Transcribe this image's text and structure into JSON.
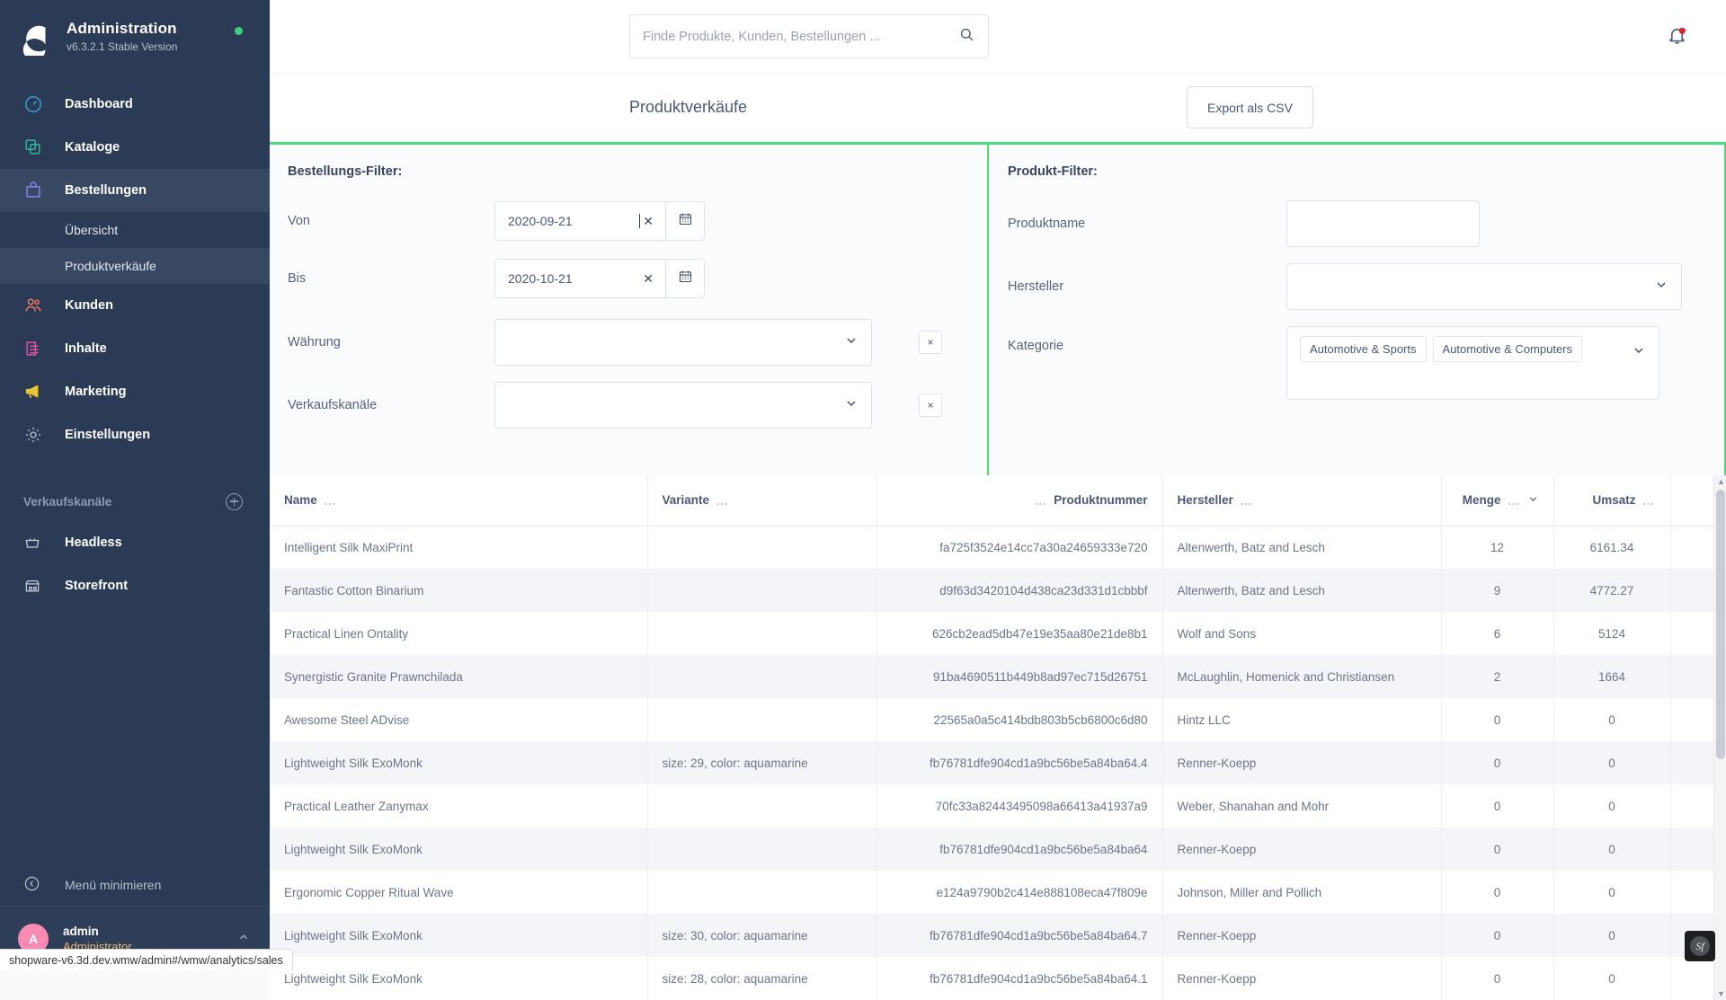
{
  "sidebar": {
    "brand": {
      "title": "Administration",
      "version": "v6.3.2.1 Stable Version",
      "status_color": "#37d27b"
    },
    "items": [
      {
        "label": "Dashboard",
        "icon": "gauge-icon",
        "color": "#3a9fd0",
        "active": false
      },
      {
        "label": "Kataloge",
        "icon": "layers-icon",
        "color": "#2fb99b",
        "active": false
      },
      {
        "label": "Bestellungen",
        "icon": "bag-icon",
        "color": "#8b7ff0",
        "active": true
      },
      {
        "label": "Kunden",
        "icon": "users-icon",
        "color": "#f07a62",
        "active": false
      },
      {
        "label": "Inhalte",
        "icon": "document-icon",
        "color": "#e04fa8",
        "active": false
      },
      {
        "label": "Marketing",
        "icon": "megaphone-icon",
        "color": "#e8c52e",
        "active": false
      },
      {
        "label": "Einstellungen",
        "icon": "gear-icon",
        "color": "#aeb6c4",
        "active": false
      }
    ],
    "sub_items": [
      {
        "label": "Übersicht",
        "active": false
      },
      {
        "label": "Produktverkäufe",
        "active": true
      }
    ],
    "section_label": "Verkaufskanäle",
    "channels": [
      {
        "label": "Headless",
        "icon": "basket-icon"
      },
      {
        "label": "Storefront",
        "icon": "shop-icon"
      }
    ],
    "minimize_label": "Menü minimieren",
    "user": {
      "initial": "A",
      "name": "admin",
      "role": "Administrator"
    }
  },
  "topbar": {
    "search_placeholder": "Finde Produkte, Kunden, Bestellungen ...",
    "search_value": "",
    "search_icon": "search-icon",
    "notification_icon": "bell-icon",
    "notification_badge": true
  },
  "page": {
    "title": "Produktverkäufe",
    "export_button": "Export als CSV",
    "accent_color": "#4ed97f"
  },
  "order_filter": {
    "title": "Bestellungs-Filter:",
    "fields": [
      {
        "label": "Von",
        "value": "2020-09-21",
        "type": "date"
      },
      {
        "label": "Bis",
        "value": "2020-10-21",
        "type": "date"
      },
      {
        "label": "Währung",
        "value": "",
        "type": "select"
      },
      {
        "label": "Verkaufskanäle",
        "value": "",
        "type": "select"
      }
    ],
    "reset_symbol": "×"
  },
  "product_filter": {
    "title": "Produkt-Filter:",
    "product_name": {
      "label": "Produktname",
      "value": "",
      "placeholder": ""
    },
    "manufacturer": {
      "label": "Hersteller",
      "value": ""
    },
    "category": {
      "label": "Kategorie",
      "chips": [
        "Automotive & Sports",
        "Automotive & Computers"
      ]
    }
  },
  "table": {
    "columns": [
      {
        "label": "Name",
        "align": "left",
        "menu": "…"
      },
      {
        "label": "Variante",
        "align": "left",
        "menu": "…"
      },
      {
        "label": "Produktnummer",
        "align": "right",
        "menu": "…"
      },
      {
        "label": "Hersteller",
        "align": "left",
        "menu": "…"
      },
      {
        "label": "Menge",
        "align": "right",
        "menu": "…",
        "sorted": true,
        "sort_icon": "chevron-down-icon"
      },
      {
        "label": "Umsatz",
        "align": "right",
        "menu": "…"
      },
      {
        "label": "",
        "align": "left",
        "menu": ""
      }
    ],
    "rows": [
      {
        "name": "Intelligent Silk MaxiPrint",
        "variante": "",
        "produktnummer": "fa725f3524e14cc7a30a24659333e720",
        "hersteller": "Altenwerth, Batz and Lesch",
        "menge": "12",
        "umsatz": "6161.34"
      },
      {
        "name": "Fantastic Cotton Binarium",
        "variante": "",
        "produktnummer": "d9f63d3420104d438ca23d331d1cbbbf",
        "hersteller": "Altenwerth, Batz and Lesch",
        "menge": "9",
        "umsatz": "4772.27"
      },
      {
        "name": "Practical Linen Ontality",
        "variante": "",
        "produktnummer": "626cb2ead5db47e19e35aa80e21de8b1",
        "hersteller": "Wolf and Sons",
        "menge": "6",
        "umsatz": "5124"
      },
      {
        "name": "Synergistic Granite Prawnchilada",
        "variante": "",
        "produktnummer": "91ba4690511b449b8ad97ec715d26751",
        "hersteller": "McLaughlin, Homenick and Christiansen",
        "menge": "2",
        "umsatz": "1664"
      },
      {
        "name": "Awesome Steel ADvise",
        "variante": "",
        "produktnummer": "22565a0a5c414bdb803b5cb6800c6d80",
        "hersteller": "Hintz LLC",
        "menge": "0",
        "umsatz": "0"
      },
      {
        "name": "Lightweight Silk ExoMonk",
        "variante": "size: 29, color: aquamarine",
        "produktnummer": "fb76781dfe904cd1a9bc56be5a84ba64.4",
        "hersteller": "Renner-Koepp",
        "menge": "0",
        "umsatz": "0"
      },
      {
        "name": "Practical Leather Zanymax",
        "variante": "",
        "produktnummer": "70fc33a82443495098a66413a41937a9",
        "hersteller": "Weber, Shanahan and Mohr",
        "menge": "0",
        "umsatz": "0"
      },
      {
        "name": "Lightweight Silk ExoMonk",
        "variante": "",
        "produktnummer": "fb76781dfe904cd1a9bc56be5a84ba64",
        "hersteller": "Renner-Koepp",
        "menge": "0",
        "umsatz": "0"
      },
      {
        "name": "Ergonomic Copper Ritual Wave",
        "variante": "",
        "produktnummer": "e124a9790b2c414e888108eca47f809e",
        "hersteller": "Johnson, Miller and Pollich",
        "menge": "0",
        "umsatz": "0"
      },
      {
        "name": "Lightweight Silk ExoMonk",
        "variante": "size: 30, color: aquamarine",
        "produktnummer": "fb76781dfe904cd1a9bc56be5a84ba64.7",
        "hersteller": "Renner-Koepp",
        "menge": "0",
        "umsatz": "0"
      },
      {
        "name": "Lightweight Silk ExoMonk",
        "variante": "size: 28, color: aquamarine",
        "produktnummer": "fb76781dfe904cd1a9bc56be5a84ba64.1",
        "hersteller": "Renner-Koepp",
        "menge": "0",
        "umsatz": "0"
      }
    ]
  },
  "statusbar": {
    "url": "shopware-v6.3d.dev.wmw/admin#/wmw/analytics/sales"
  },
  "debug_toolbar": {
    "label": "Sf",
    "icon": "symfony-icon"
  }
}
